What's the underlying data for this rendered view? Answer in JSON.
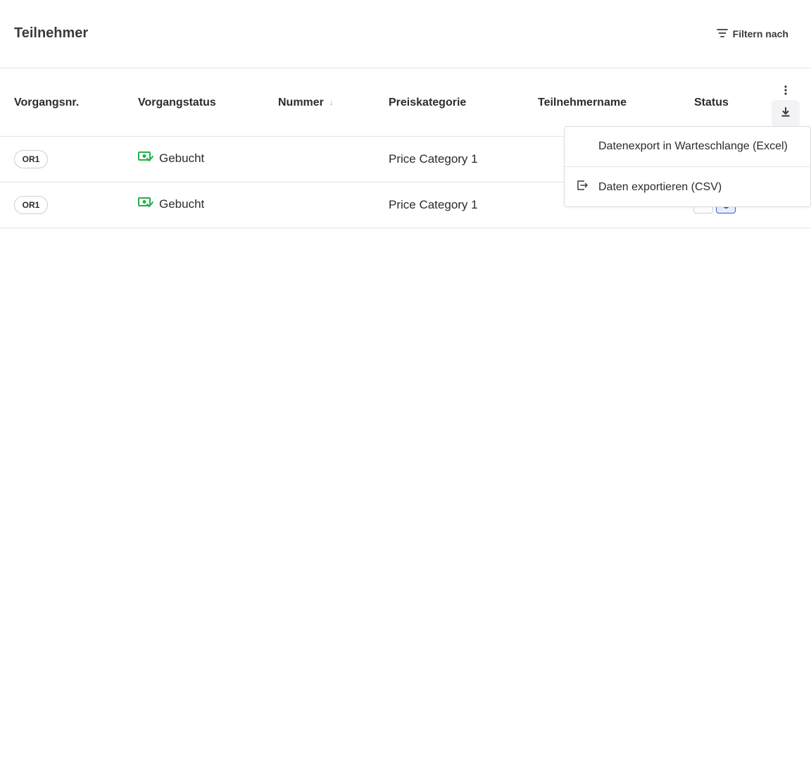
{
  "header": {
    "title": "Teilnehmer",
    "filter_label": "Filtern nach",
    "filter_icon": "filter-icon"
  },
  "table": {
    "columns": [
      {
        "label": "Vorgangsnr."
      },
      {
        "label": "Vorgangstatus"
      },
      {
        "label": "Nummer",
        "sort": "↓"
      },
      {
        "label": "Preiskategorie"
      },
      {
        "label": "Teilnehmername"
      },
      {
        "label": "Status"
      }
    ],
    "rows": [
      {
        "order": "OR1",
        "status": "Gebucht",
        "price_category": "Price Category 1"
      },
      {
        "order": "OR1",
        "status": "Gebucht",
        "price_category": "Price Category 1"
      }
    ]
  },
  "export_menu": {
    "items": [
      {
        "label": "Datenexport in Warteschlange (Excel)"
      },
      {
        "label": "Daten exportieren (CSV)",
        "icon": "export-icon"
      }
    ]
  },
  "colors": {
    "accent_green": "#22b04a",
    "accent_blue": "#2f5bd8"
  }
}
